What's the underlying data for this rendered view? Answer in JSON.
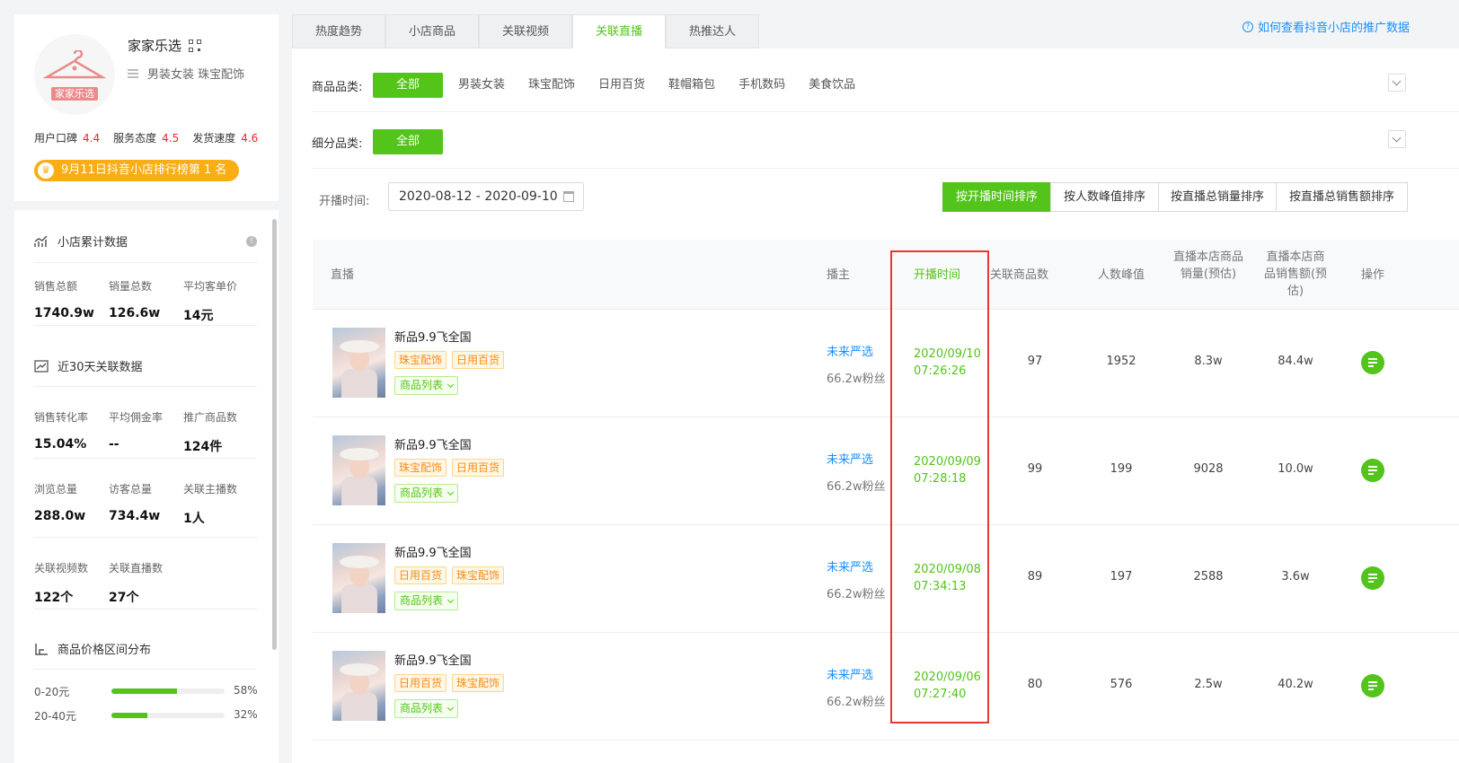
{
  "shop": {
    "name": "家家乐选",
    "avatar_text": "家家乐选",
    "categories": "男装女装 珠宝配饰",
    "ratings": [
      {
        "label": "用户口碑",
        "value": "4.4"
      },
      {
        "label": "服务态度",
        "value": "4.5"
      },
      {
        "label": "发货速度",
        "value": "4.6"
      }
    ],
    "rank_text": "9月11日抖音小店排行榜第 1 名"
  },
  "stats": {
    "cumulative_title": "小店累计数据",
    "cumulative": [
      {
        "label": "销售总额",
        "value": "1740.9w"
      },
      {
        "label": "销量总数",
        "value": "126.6w"
      },
      {
        "label": "平均客单价",
        "value": "14元"
      }
    ],
    "recent_title": "近30天关联数据",
    "recent_row1": [
      {
        "label": "销售转化率",
        "value": "15.04%"
      },
      {
        "label": "平均佣金率",
        "value": "--"
      },
      {
        "label": "推广商品数",
        "value": "124件"
      }
    ],
    "recent_row2": [
      {
        "label": "浏览总量",
        "value": "288.0w"
      },
      {
        "label": "访客总量",
        "value": "734.4w"
      },
      {
        "label": "关联主播数",
        "value": "1人"
      }
    ],
    "recent_row3": [
      {
        "label": "关联视频数",
        "value": "122个"
      },
      {
        "label": "关联直播数",
        "value": "27个"
      }
    ],
    "price_title": "商品价格区间分布",
    "price_ranges": [
      {
        "label": "0-20元",
        "percent": 58,
        "percent_text": "58%"
      },
      {
        "label": "20-40元",
        "percent": 32,
        "percent_text": "32%"
      }
    ]
  },
  "tabs": [
    "热度趋势",
    "小店商品",
    "关联视频",
    "关联直播",
    "热推达人"
  ],
  "active_tab": 3,
  "help_link": "如何查看抖音小店的推广数据",
  "filters": {
    "category_label": "商品品类:",
    "category_options": [
      "全部",
      "男装女装",
      "珠宝配饰",
      "日用百货",
      "鞋帽箱包",
      "手机数码",
      "美食饮品"
    ],
    "sub_label": "细分品类:",
    "sub_options": [
      "全部"
    ]
  },
  "date": {
    "label": "开播时间:",
    "range": "2020-08-12 - 2020-09-10"
  },
  "sort_buttons": [
    "按开播时间排序",
    "按人数峰值排序",
    "按直播总销量排序",
    "按直播总销售额排序"
  ],
  "table": {
    "headers": {
      "live": "直播",
      "anchor": "播主",
      "start_time": "开播时间",
      "goods_count": "关联商品数",
      "peak_viewers": "人数峰值",
      "sales_volume": "直播本店商品销量(预估)",
      "sales_amount": "直播本店商品销售额(预估)",
      "action": "操作"
    },
    "goods_list_label": "商品列表",
    "rows": [
      {
        "title": "新品9.9飞全国",
        "tags": [
          "珠宝配饰",
          "日用百货"
        ],
        "anchor": "未来严选",
        "fans": "66.2w粉丝",
        "date": "2020/09/10",
        "time": "07:26:26",
        "goods": "97",
        "peak": "1952",
        "volume": "8.3w",
        "amount": "84.4w"
      },
      {
        "title": "新品9.9飞全国",
        "tags": [
          "珠宝配饰",
          "日用百货"
        ],
        "anchor": "未来严选",
        "fans": "66.2w粉丝",
        "date": "2020/09/09",
        "time": "07:28:18",
        "goods": "99",
        "peak": "199",
        "volume": "9028",
        "amount": "10.0w"
      },
      {
        "title": "新品9.9飞全国",
        "tags": [
          "日用百货",
          "珠宝配饰"
        ],
        "anchor": "未来严选",
        "fans": "66.2w粉丝",
        "date": "2020/09/08",
        "time": "07:34:13",
        "goods": "89",
        "peak": "197",
        "volume": "2588",
        "amount": "3.6w"
      },
      {
        "title": "新品9.9飞全国",
        "tags": [
          "日用百货",
          "珠宝配饰"
        ],
        "anchor": "未来严选",
        "fans": "66.2w粉丝",
        "date": "2020/09/06",
        "time": "07:27:40",
        "goods": "80",
        "peak": "576",
        "volume": "2.5w",
        "amount": "40.2w"
      }
    ]
  },
  "colors": {
    "accent": "#52c41a",
    "link": "#1890ff",
    "rating": "#f5222d",
    "badge": "#faad14",
    "highlight_box": "#e53935"
  }
}
